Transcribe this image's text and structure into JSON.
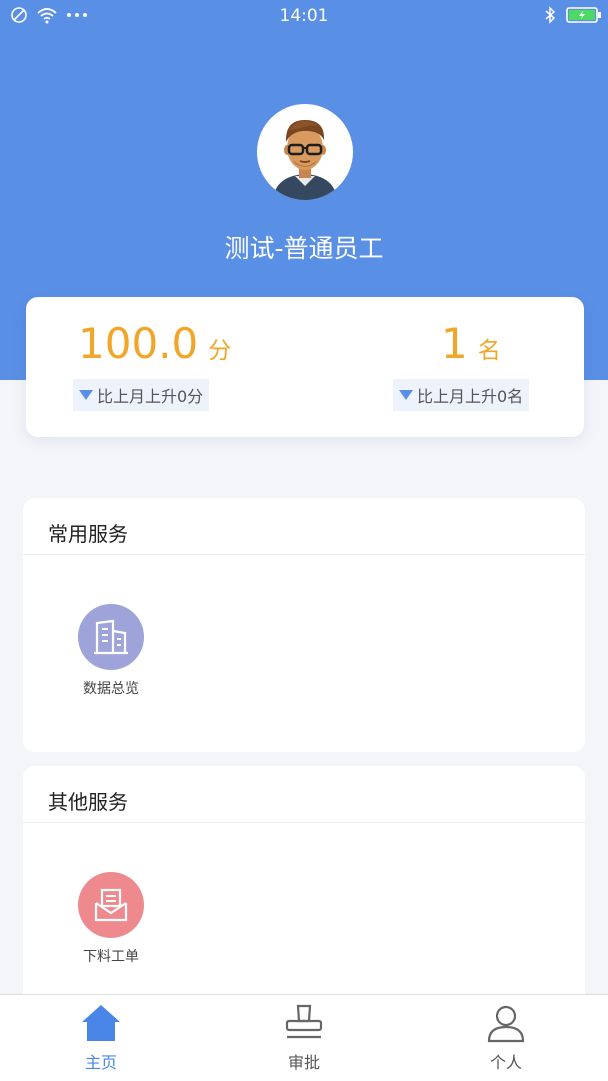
{
  "status_bar": {
    "time": "14:01",
    "icons": [
      "no-sim-icon",
      "wifi-icon",
      "more-dots-icon",
      "bluetooth-icon",
      "battery-charging-icon"
    ]
  },
  "profile": {
    "name": "测试-普通员工"
  },
  "stats": {
    "score": {
      "value": "100.0",
      "unit": "分",
      "change": "比上月上升0分"
    },
    "rank": {
      "value": "1",
      "unit": "名",
      "change": "比上月上升0名"
    }
  },
  "sections": {
    "common": {
      "title": "常用服务",
      "items": [
        {
          "label": "数据总览",
          "icon": "building-icon",
          "color": "#9ea4d9"
        }
      ]
    },
    "other": {
      "title": "其他服务",
      "items": [
        {
          "label": "下料工单",
          "icon": "mail-document-icon",
          "color": "#ee8a8d"
        }
      ]
    }
  },
  "bottom_nav": [
    {
      "label": "主页",
      "icon": "home-icon",
      "active": true
    },
    {
      "label": "审批",
      "icon": "stamp-icon",
      "active": false
    },
    {
      "label": "个人",
      "icon": "person-icon",
      "active": false
    }
  ],
  "colors": {
    "header": "#5a8fe6",
    "accent": "#f1a628",
    "nav_active": "#4a86e8"
  }
}
